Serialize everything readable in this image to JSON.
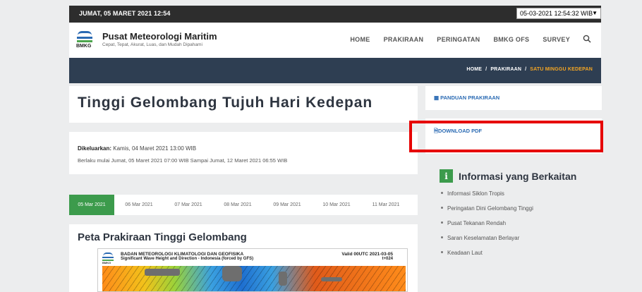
{
  "topbar": {
    "date": "JUMAT, 05 MARET 2021 12:54",
    "clock_select": "05-03-2021 12:54:32 WIB"
  },
  "brand": {
    "logo_text": "BMKG",
    "title": "Pusat Meteorologi Maritim",
    "tagline": "Cepat, Tepat, Akurat, Luas, dan Mudah Dipahami"
  },
  "nav": {
    "items": [
      "HOME",
      "PRAKIRAAN",
      "PERINGATAN",
      "BMKG OFS",
      "SURVEY"
    ],
    "search_icon": "search-icon"
  },
  "breadcrumb": {
    "items": [
      "HOME",
      "PRAKIRAAN",
      "SATU MINGGU KEDEPAN"
    ],
    "separator": "/"
  },
  "page": {
    "title": "Tinggi Gelombang Tujuh Hari Kedepan",
    "issued_label": "Dikeluarkan:",
    "issued_value": "Kamis, 04 Maret 2021 13:00 WIB",
    "valid_text": "Berlaku mulai Jumat, 05 Maret 2021 07:00 WIB Sampai Jumat, 12 Maret 2021 06:55 WIB"
  },
  "tabs": [
    "05 Mar 2021",
    "06 Mar 2021",
    "07 Mar 2021",
    "08 Mar 2021",
    "09 Mar 2021",
    "10 Mar 2021",
    "11 Mar 2021"
  ],
  "map": {
    "heading": "Peta Prakiraan Tinggi Gelombang",
    "logo_text": "BMKG",
    "org": "BADAN METEOROLOGI KLIMATOLOGI DAN GEOFISIKA",
    "subtitle": "Significant Wave Height and Direction - Indonesia (forced by GFS)",
    "valid": "Valid 00UTC 2021-03-05",
    "step": "t+024"
  },
  "sidebar": {
    "guide_link": "PANDUAN PRAKIRAAN",
    "download_link": "DOWNLOAD PDF",
    "info_title": "Informasi yang Berkaitan",
    "info_icon": "i",
    "info_items": [
      "Informasi Siklon Tropis",
      "Peringatan Dini Gelombang Tinggi",
      "Pusat Tekanan Rendah",
      "Saran Keselamatan Berlayar",
      "Keadaan Laut"
    ]
  },
  "colors": {
    "accent_green": "#3c9b4c",
    "link_blue": "#2a6ab3",
    "breadcrumb_active": "#f5a623",
    "highlight_red": "#e60000"
  }
}
